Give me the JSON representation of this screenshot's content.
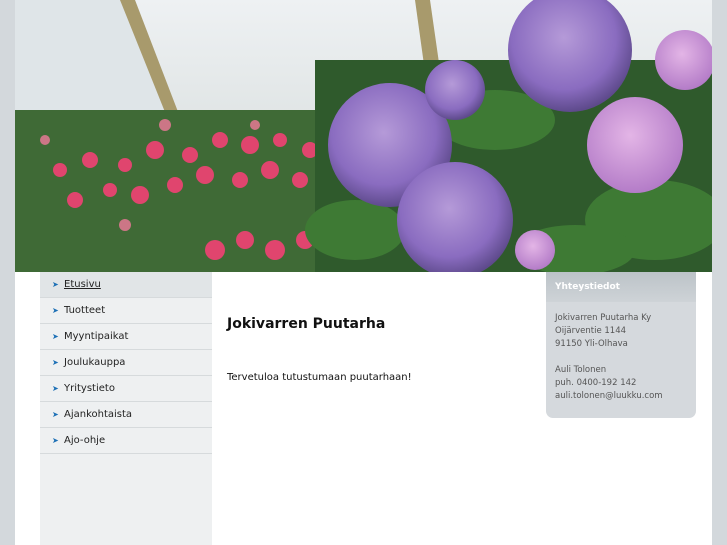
{
  "nav": {
    "items": [
      {
        "label": "Etusivu",
        "active": true
      },
      {
        "label": "Tuotteet"
      },
      {
        "label": "Myyntipaikat"
      },
      {
        "label": "Joulukauppa"
      },
      {
        "label": "Yritystieto"
      },
      {
        "label": "Ajankohtaista"
      },
      {
        "label": "Ajo-ohje"
      }
    ]
  },
  "main": {
    "title": "Jokivarren Puutarha",
    "welcome": "Tervetuloa tutustumaan puutarhaan!"
  },
  "contact": {
    "title": "Yhteystiedot",
    "company": "Jokivarren Puutarha Ky",
    "street": "Oijärventie 1144",
    "postal": "91150 Yli-Olhava",
    "person": "Auli Tolonen",
    "phone": "puh. 0400-192 142",
    "email": "auli.tolonen@luukku.com"
  },
  "colors": {
    "page_bg": "#d3d8dc",
    "sidebar_bg": "#eef0f1",
    "contact_bg": "#d5d9dd",
    "accent": "#1b6fb5"
  }
}
